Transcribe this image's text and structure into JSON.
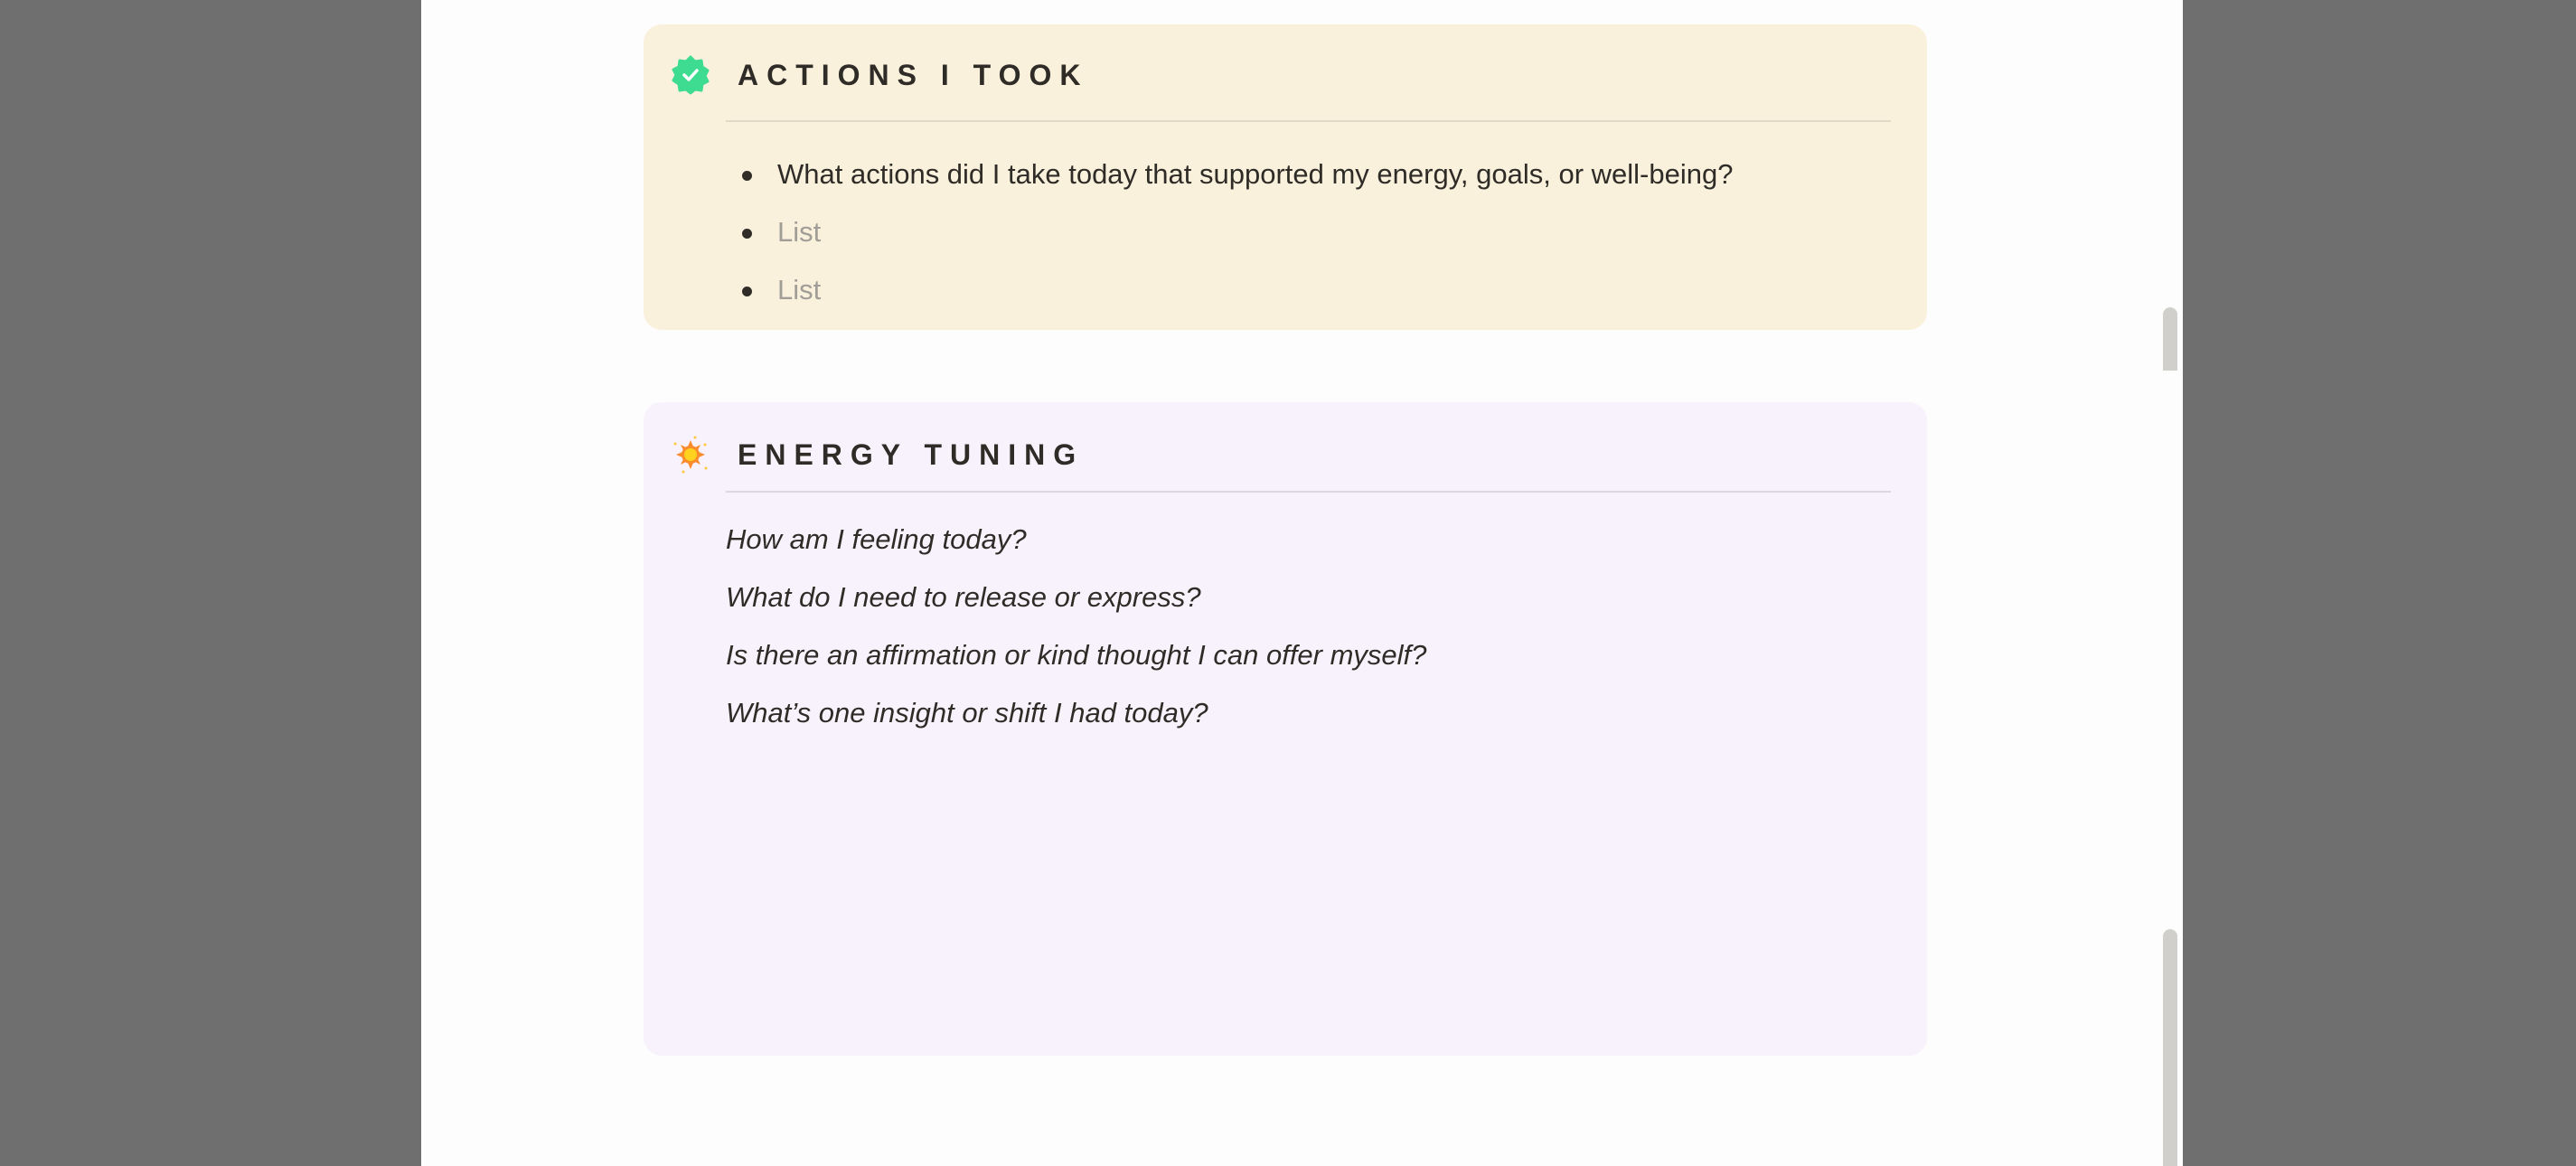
{
  "actions": {
    "icon": "verified-badge-icon",
    "title": "ACTIONS I TOOK",
    "items": [
      {
        "text": "What actions did I take today that supported my energy, goals, or well-being?",
        "placeholder": false
      },
      {
        "text": "List",
        "placeholder": true
      },
      {
        "text": "List",
        "placeholder": true
      }
    ]
  },
  "energy": {
    "icon": "sun-icon",
    "title": "ENERGY TUNING",
    "prompts": [
      "How am I feeling today?",
      "What do I need to release or express?",
      "Is there an affirmation or kind thought I can offer myself?",
      "What’s one insight or shift I had today?"
    ]
  },
  "colors": {
    "actions_bg": "#faf1dc",
    "energy_bg": "#f7f2fc",
    "badge": "#3ddc91"
  }
}
